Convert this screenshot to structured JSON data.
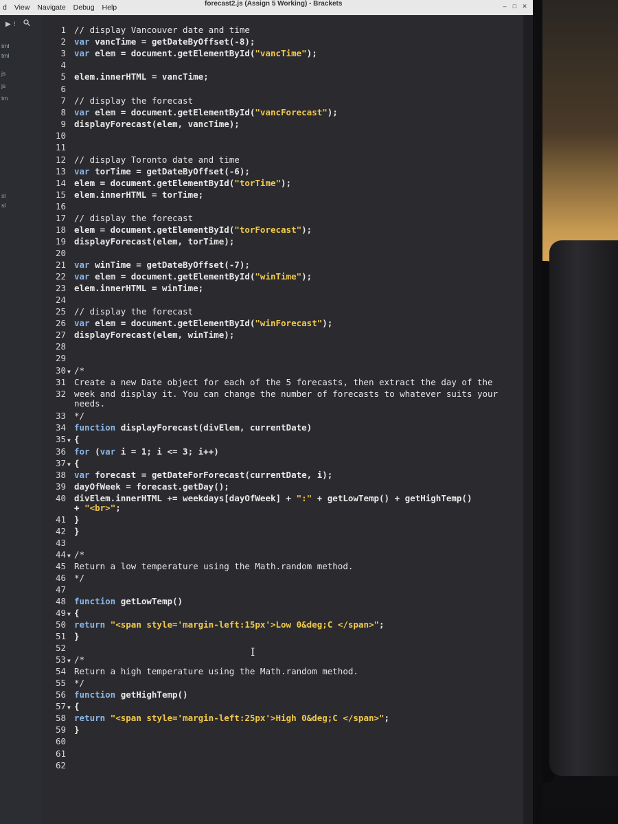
{
  "menubar": {
    "items": [
      "d",
      "View",
      "Navigate",
      "Debug",
      "Help"
    ],
    "window_title": "forecast2.js (Assign 5 Working) - Brackets",
    "controls": [
      "–",
      "□",
      "✕"
    ]
  },
  "sidebar": {
    "tool_icons": [
      "▶",
      "⁝",
      "search-icon"
    ],
    "files": [
      "tml",
      "tml",
      "js",
      "js",
      "tm",
      "sl",
      "sl"
    ]
  },
  "lines": [
    {
      "n": "1",
      "code": "// display Vancouver date and time"
    },
    {
      "n": "2",
      "code": "var vancTime = getDateByOffset(-8);"
    },
    {
      "n": "3",
      "code": "var elem = document.getElementById(\"vancTime\");"
    },
    {
      "n": "4",
      "code": ""
    },
    {
      "n": "5",
      "code": "elem.innerHTML = vancTime;"
    },
    {
      "n": "6",
      "code": ""
    },
    {
      "n": "7",
      "code": "// display the forecast"
    },
    {
      "n": "8",
      "code": "var elem = document.getElementById(\"vancForecast\");"
    },
    {
      "n": "9",
      "code": "displayForecast(elem, vancTime);"
    },
    {
      "n": "10",
      "code": ""
    },
    {
      "n": "11",
      "code": ""
    },
    {
      "n": "12",
      "code": "// display Toronto date and time"
    },
    {
      "n": "13",
      "code": "var torTime = getDateByOffset(-6);"
    },
    {
      "n": "14",
      "code": "elem = document.getElementById(\"torTime\");"
    },
    {
      "n": "15",
      "code": "elem.innerHTML = torTime;"
    },
    {
      "n": "16",
      "code": ""
    },
    {
      "n": "17",
      "code": "// display the forecast"
    },
    {
      "n": "18",
      "code": "elem = document.getElementById(\"torForecast\");"
    },
    {
      "n": "19",
      "code": "displayForecast(elem, torTime);"
    },
    {
      "n": "20",
      "code": ""
    },
    {
      "n": "21",
      "code": "var winTime = getDateByOffset(-7);"
    },
    {
      "n": "22",
      "code": "var elem = document.getElementById(\"winTime\");"
    },
    {
      "n": "23",
      "code": "elem.innerHTML = winTime;"
    },
    {
      "n": "24",
      "code": ""
    },
    {
      "n": "25",
      "code": "// display the forecast"
    },
    {
      "n": "26",
      "code": "var elem = document.getElementById(\"winForecast\");"
    },
    {
      "n": "27",
      "code": "displayForecast(elem, winTime);"
    },
    {
      "n": "28",
      "code": ""
    },
    {
      "n": "29",
      "code": ""
    },
    {
      "n": "30",
      "code": "/*",
      "fold": "▼"
    },
    {
      "n": "31",
      "code": "Create a new Date object for each of the 5 forecasts, then extract the day of the"
    },
    {
      "n": "32",
      "code": "week and display it.  You can change the number of forecasts to whatever suits your"
    },
    {
      "n": "",
      "code": "needs."
    },
    {
      "n": "33",
      "code": "*/"
    },
    {
      "n": "34",
      "code": "function displayForecast(divElem, currentDate)"
    },
    {
      "n": "35",
      "code": "{",
      "fold": "▼"
    },
    {
      "n": "36",
      "code": "   for (var i = 1; i <= 3; i++)"
    },
    {
      "n": "37",
      "code": "   {",
      "fold": "▼"
    },
    {
      "n": "38",
      "code": "      var forecast = getDateForForecast(currentDate, i);"
    },
    {
      "n": "39",
      "code": "      dayOfWeek = forecast.getDay();"
    },
    {
      "n": "40",
      "code": "      divElem.innerHTML += weekdays[dayOfWeek] + \":\" + getLowTemp() + getHighTemp()"
    },
    {
      "n": "",
      "code": "      + \"<br>\";"
    },
    {
      "n": "41",
      "code": "   }"
    },
    {
      "n": "42",
      "code": "}"
    },
    {
      "n": "43",
      "code": ""
    },
    {
      "n": "44",
      "code": "/*",
      "fold": "▼"
    },
    {
      "n": "45",
      "code": "Return a low temperature using the Math.random method."
    },
    {
      "n": "46",
      "code": "*/"
    },
    {
      "n": "47",
      "code": ""
    },
    {
      "n": "48",
      "code": "function getLowTemp()"
    },
    {
      "n": "49",
      "code": "{",
      "fold": "▼"
    },
    {
      "n": "50",
      "code": "   return \"<span style='margin-left:15px'>Low 0&deg;C </span>\";"
    },
    {
      "n": "51",
      "code": "}"
    },
    {
      "n": "52",
      "code": ""
    },
    {
      "n": "53",
      "code": "/*",
      "fold": "▼"
    },
    {
      "n": "54",
      "code": "Return a high temperature using the Math.random method."
    },
    {
      "n": "55",
      "code": "*/"
    },
    {
      "n": "56",
      "code": "function getHighTemp()"
    },
    {
      "n": "57",
      "code": "{",
      "fold": "▼"
    },
    {
      "n": "58",
      "code": "   return \"<span style='margin-left:25px'>High 0&deg;C </span>\";"
    },
    {
      "n": "59",
      "code": "}"
    },
    {
      "n": "60",
      "code": ""
    },
    {
      "n": "61",
      "code": ""
    },
    {
      "n": "62",
      "code": ""
    }
  ],
  "cursor_glyph": "I"
}
